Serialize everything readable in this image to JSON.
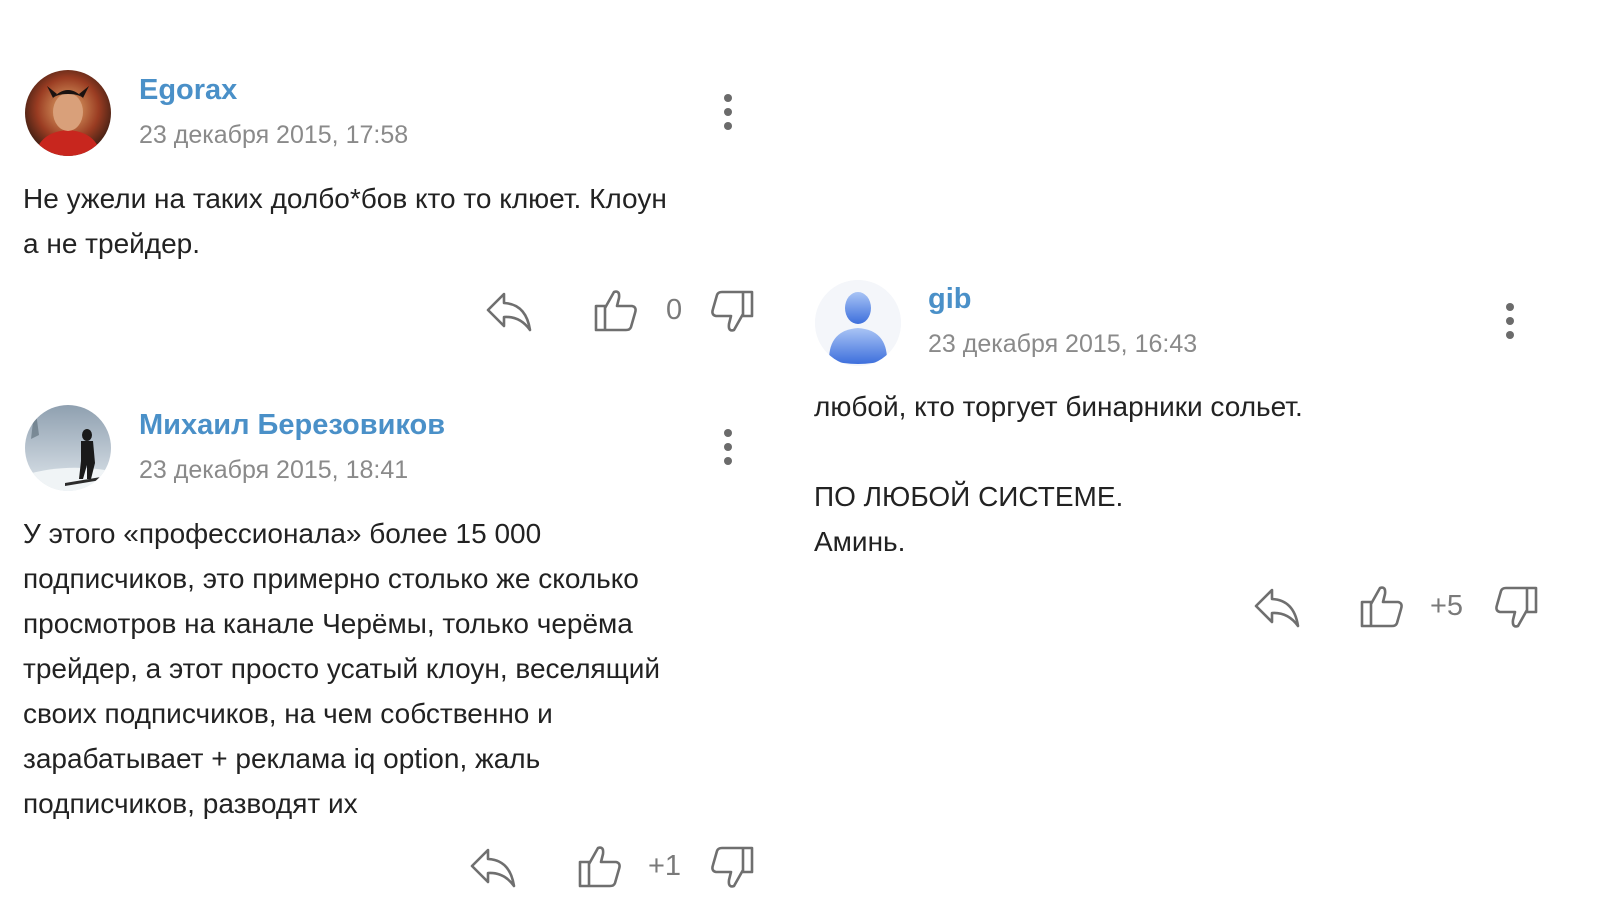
{
  "comments": [
    {
      "author": "Egorax",
      "date": "23 декабря 2015, 17:58",
      "lines": [
        "Не ужели на таких долбо*бов кто то клюет. Клоун",
        "а не трейдер."
      ],
      "score": "0",
      "avatar_icon": "user-avatar-photo"
    },
    {
      "author": "Михаил Березовиков",
      "date": "23 декабря 2015, 18:41",
      "lines": [
        "У этого «профессионала» более 15 000",
        "подписчиков, это примерно столько же сколько",
        "просмотров на канале Черёмы, только черёма",
        "трейдер, а этот просто усатый клоун, веселящий",
        "своих подписчиков, на чем собственно и",
        "зарабатывает + реклама iq option, жаль",
        "подписчиков, разводят их"
      ],
      "score": "+1",
      "avatar_icon": "user-avatar-photo"
    },
    {
      "author": "gib",
      "date": "23 декабря 2015, 16:43",
      "lines": [
        "любой, кто торгует бинарники сольет.",
        "",
        "ПО ЛЮБОЙ СИСТЕМЕ.",
        "Аминь."
      ],
      "score": "+5",
      "avatar_icon": "default-user-avatar"
    }
  ],
  "colors": {
    "author": "#4a90c8",
    "date": "#8a8a8a",
    "text": "#222222",
    "icon": "#6f6f6f"
  }
}
